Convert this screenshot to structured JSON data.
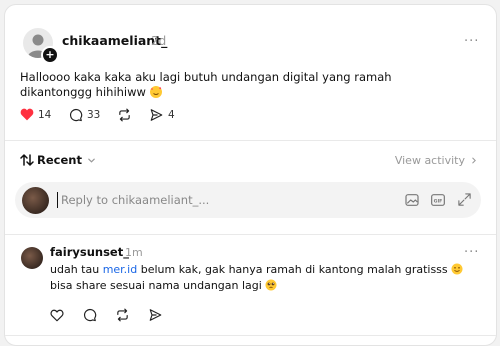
{
  "post": {
    "username": "chikaameliant_",
    "time": "2d",
    "text": "Halloooo kaka kaka aku lagi butuh undangan digital yang ramah dikantonggg hihihiww",
    "likes": "14",
    "comments": "33",
    "shares": "4",
    "more": "···"
  },
  "sort": {
    "label": "Recent",
    "view_activity": "View activity"
  },
  "reply": {
    "placeholder": "Reply to chikaameliant_..."
  },
  "comment": {
    "username": "fairysunset_",
    "time": "1m",
    "text_before_link": "udah tau ",
    "link": "mer.id",
    "text_after_link": " belum kak, gak hanya ramah di kantong malah gratisss",
    "line2": "bisa share sesuai nama undangan lagi",
    "more": "···"
  },
  "icons": {
    "heart": "heart-icon",
    "comment": "comment-icon",
    "repost": "repost-icon",
    "share": "share-icon",
    "gif": "gif-icon",
    "image": "image-icon",
    "expand": "expand-icon"
  },
  "colors": {
    "heart": "#ff3040",
    "link": "#1a66e6"
  }
}
